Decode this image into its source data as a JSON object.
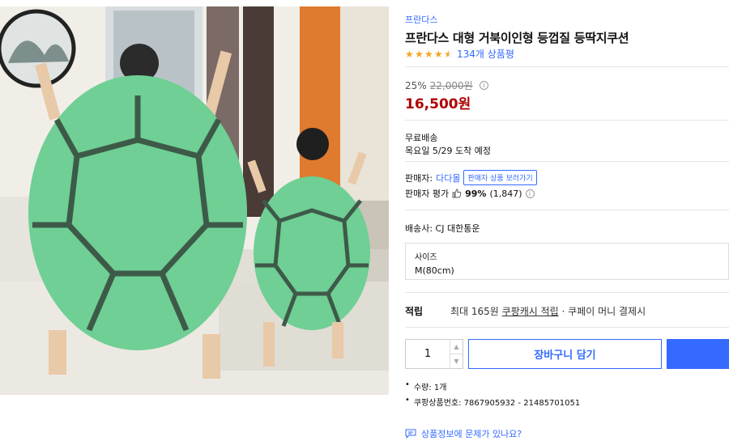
{
  "product_image": {
    "alt_icon": "turtle-shell-cushion-photo"
  },
  "brand": "프란다스",
  "title": "프란다스 대형 거북이인형 등껍질 등딱지쿠션",
  "rating": {
    "stars": 4.5,
    "max": 5,
    "reviews_label": "134개 상품평"
  },
  "price": {
    "discount": "25%",
    "original": "22,000원",
    "sale": "16,500원"
  },
  "shipping": {
    "label": "무료배송",
    "date": "목요일 5/29 도착 예정"
  },
  "seller": {
    "label": "판매자:",
    "name": "다다몰",
    "button": "판매자 상품 보러가기",
    "rating_label": "판매자 평가",
    "rating_pct": "99%",
    "rating_count": "(1,847)"
  },
  "carrier": "배송사: CJ 대한통운",
  "option": {
    "label": "사이즈",
    "value": "M(80cm)"
  },
  "reward": {
    "label": "적립",
    "prefix": "최대 165원 ",
    "link": "쿠팡캐시 적립",
    "suffix": " · 쿠페이 머니 결제시"
  },
  "purchase": {
    "quantity": "1",
    "cart_label": "장바구니 담기"
  },
  "details": {
    "qty_line": "수량: 1개",
    "product_no": "쿠팡상품번호: 7867905932 - 21485701051"
  },
  "problem_link": "상품정보에 문제가 있나요?",
  "colors": {
    "accent": "#346aff",
    "sale": "#ae0000",
    "star": "#f5a623",
    "shell": "#6fcf94"
  }
}
